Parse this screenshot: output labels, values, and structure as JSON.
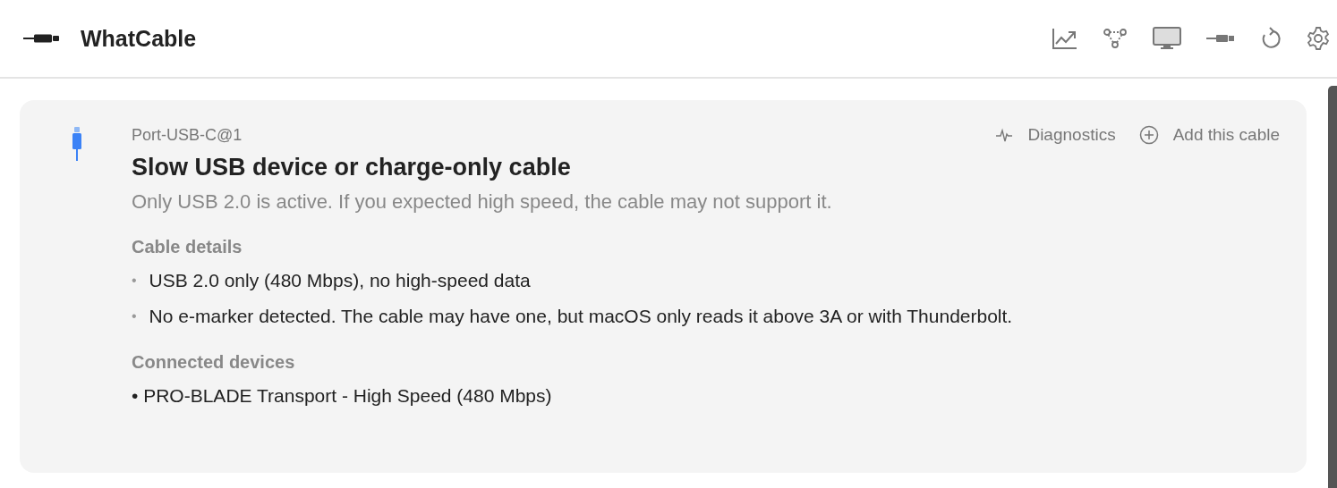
{
  "app": {
    "title": "WhatCable"
  },
  "toolbar": [
    {
      "kind": "chart"
    },
    {
      "kind": "topology"
    },
    {
      "kind": "display"
    },
    {
      "kind": "cable"
    },
    {
      "kind": "refresh"
    },
    {
      "kind": "settings"
    }
  ],
  "port": {
    "name": "Port-USB-C@1",
    "title": "Slow USB device or charge-only cable",
    "description": "Only USB 2.0 is active. If you expected high speed, the cable may not support it.",
    "actions": [
      {
        "kind": "diagnostics",
        "label": "Diagnostics"
      },
      {
        "kind": "add",
        "label": "Add this cable"
      }
    ],
    "sections": [
      {
        "heading": "Cable details",
        "bullet": "•",
        "items": [
          "USB 2.0 only (480 Mbps), no high-speed data",
          "No e-marker detected. The cable may have one, but macOS only reads it above 3A or with Thunderbolt."
        ]
      },
      {
        "heading": "Connected devices",
        "items": [
          "• PRO-BLADE Transport - High Speed (480 Mbps)"
        ]
      }
    ]
  }
}
